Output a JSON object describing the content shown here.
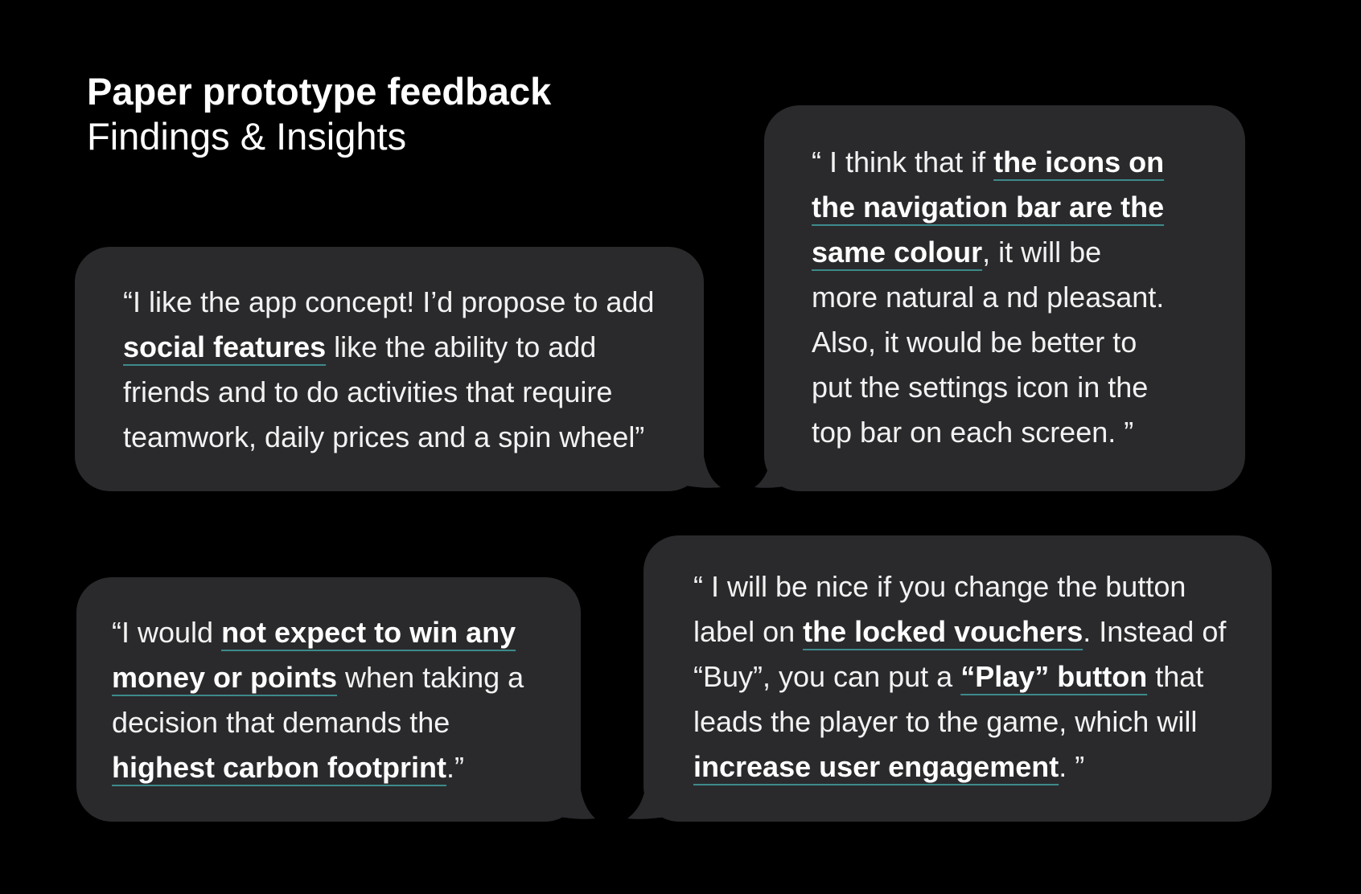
{
  "header": {
    "title": "Paper prototype feedback",
    "subtitle": "Findings & Insights"
  },
  "colors": {
    "background": "#000000",
    "bubble": "#2a2a2d",
    "text": "#ffffff",
    "underline_accent": "#3e8a8a"
  },
  "quotes": [
    {
      "id": "social-features",
      "segments": [
        {
          "text": "“I like the app concept! I’d propose to add",
          "bold": false
        },
        {
          "break": true
        },
        {
          "text": "social features",
          "bold": true
        },
        {
          "text": " like the ability to add",
          "bold": false
        },
        {
          "break": true
        },
        {
          "text": "friends and to do activities that require",
          "bold": false
        },
        {
          "break": true
        },
        {
          "text": "teamwork, daily prices and a spin wheel”",
          "bold": false
        }
      ]
    },
    {
      "id": "navigation-icons",
      "segments": [
        {
          "text": "“ I think that if ",
          "bold": false
        },
        {
          "text": "the icons on",
          "bold": true
        },
        {
          "break": true
        },
        {
          "text": "the navigation bar are the",
          "bold": true
        },
        {
          "break": true
        },
        {
          "text": "same colour",
          "bold": true
        },
        {
          "text": ", it will be",
          "bold": false
        },
        {
          "break": true
        },
        {
          "text": "more natural a nd pleasant.",
          "bold": false
        },
        {
          "break": true
        },
        {
          "text": "Also, it would be better to",
          "bold": false
        },
        {
          "break": true
        },
        {
          "text": "put the settings icon in the",
          "bold": false
        },
        {
          "break": true
        },
        {
          "text": "top bar on each screen. ”",
          "bold": false
        }
      ]
    },
    {
      "id": "carbon-footprint",
      "segments": [
        {
          "text": "“I would ",
          "bold": false
        },
        {
          "text": "not expect to win any",
          "bold": true
        },
        {
          "break": true
        },
        {
          "text": "money or points",
          "bold": true
        },
        {
          "text": " when taking a",
          "bold": false
        },
        {
          "break": true
        },
        {
          "text": "decision that demands the",
          "bold": false
        },
        {
          "break": true
        },
        {
          "text": "highest carbon footprint",
          "bold": true
        },
        {
          "text": ".”",
          "bold": false
        }
      ]
    },
    {
      "id": "locked-vouchers",
      "segments": [
        {
          "text": "“ I will be nice if you change the button",
          "bold": false
        },
        {
          "break": true
        },
        {
          "text": "label on ",
          "bold": false
        },
        {
          "text": "the locked vouchers",
          "bold": true
        },
        {
          "text": ". Instead of",
          "bold": false
        },
        {
          "break": true
        },
        {
          "text": "“Buy”, you can put a ",
          "bold": false
        },
        {
          "text": "“Play” button",
          "bold": true
        },
        {
          "text": " that",
          "bold": false
        },
        {
          "break": true
        },
        {
          "text": "leads the player to the game, which will",
          "bold": false
        },
        {
          "break": true
        },
        {
          "text": "increase user engagement",
          "bold": true
        },
        {
          "text": ". ”",
          "bold": false
        }
      ]
    }
  ]
}
